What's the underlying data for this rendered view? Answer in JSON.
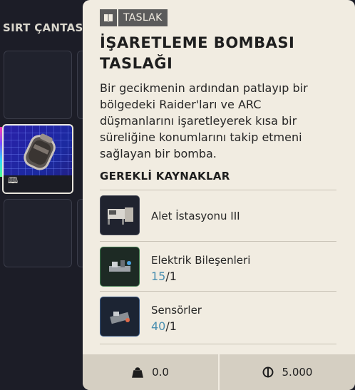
{
  "backpack": {
    "title": "SIRT ÇANTASI"
  },
  "tooltip": {
    "badge": {
      "icon": "blueprint-book-icon",
      "label": "TASLAK"
    },
    "title": "İŞARETLEME BOMBASI TASLAĞI",
    "description": "Bir gecikmenin ardından patlayıp bir bölgedeki Raider'ları ve ARC düşmanlarını işaretleyerek kısa bir süreliğine konumlarını takip etmeni sağlayan bir bomba.",
    "requirements_title": "GEREKLİ KAYNAKLAR",
    "requirements": [
      {
        "name": "Alet İstasyonu III",
        "icon": "workbench-icon"
      },
      {
        "name": "Elektrik Bileşenleri",
        "have": "15",
        "need": "/1",
        "icon": "electrical-components-icon",
        "border_color": "#3f7d4f"
      },
      {
        "name": "Sensörler",
        "have": "40",
        "need": "/1",
        "icon": "sensors-icon",
        "border_color": "#3a5a86"
      }
    ],
    "footer": {
      "weight": "0.0",
      "weight_icon": "weight-icon",
      "value": "5.000",
      "value_icon": "coin-icon"
    }
  },
  "colors": {
    "tooltip_bg": "#f1ece1",
    "footer_bg": "#d5cfc2",
    "have_qty": "#4a8fb0",
    "selected_slot": "#2a1fa8"
  }
}
